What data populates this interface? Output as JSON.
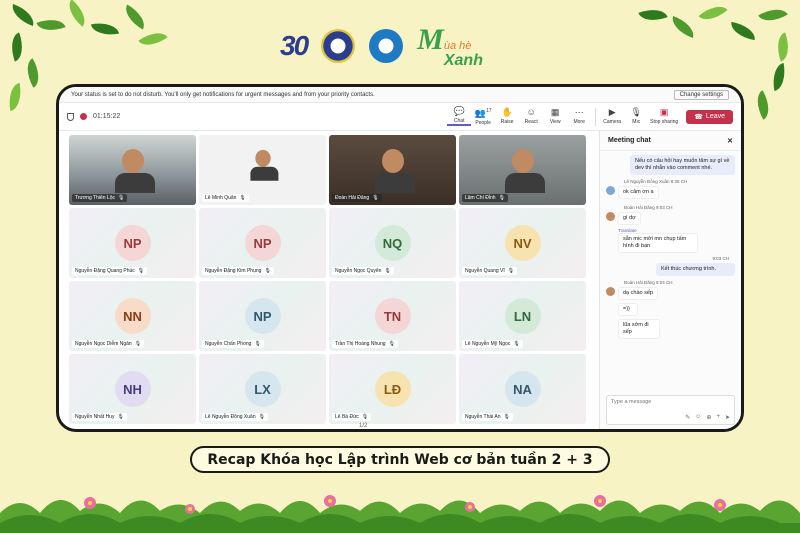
{
  "logos": {
    "brand_30": "30",
    "brand_mua_he": "ùa hè",
    "brand_xanh": "Xanh"
  },
  "notice": {
    "text": "Your status is set to do not disturb. You'll only get notifications for urgent messages and from your priority contacts.",
    "button": "Change settings"
  },
  "toolbar": {
    "timer": "01:15:22",
    "chat": "Chat",
    "people": "People",
    "people_count": "17",
    "raise": "Raise",
    "react": "React",
    "view": "View",
    "more": "More",
    "camera": "Camera",
    "mic": "Mic",
    "share": "Stop sharing",
    "leave": "Leave"
  },
  "participants": [
    {
      "name": "Trương Thiên Lộc",
      "initials": "",
      "type": "video1"
    },
    {
      "name": "Lê Minh Quân",
      "initials": "",
      "type": "video2"
    },
    {
      "name": "Đoàn Hải Đăng",
      "initials": "",
      "type": "video3"
    },
    {
      "name": "Lâm Chí Đỉnh",
      "initials": "",
      "type": "video4"
    },
    {
      "name": "Nguyễn Đặng Quang Phúc",
      "initials": "NP",
      "color": "#f5d6d6",
      "text": "#9a3a3a"
    },
    {
      "name": "Nguyễn Đặng Kim Phụng",
      "initials": "NP",
      "color": "#f5d6d6",
      "text": "#9a3a3a"
    },
    {
      "name": "Nguyễn Ngọc Quyên",
      "initials": "NQ",
      "color": "#d3ead8",
      "text": "#2f6b3c"
    },
    {
      "name": "Nguyễn Quang Vĩ",
      "initials": "NV",
      "color": "#f6e3b0",
      "text": "#8a5a10"
    },
    {
      "name": "Nguyễn Ngọc Diễm Ngân",
      "initials": "NN",
      "color": "#f8dcc8",
      "text": "#8a3e12"
    },
    {
      "name": "Nguyễn Chấn Phong",
      "initials": "NP",
      "color": "#d6e6ee",
      "text": "#2f5a6e"
    },
    {
      "name": "Trần Thị Hoàng Nhung",
      "initials": "TN",
      "color": "#f5d6d6",
      "text": "#9a3a3a"
    },
    {
      "name": "Lê Nguyễn Mỹ Ngọc",
      "initials": "LN",
      "color": "#d3ead8",
      "text": "#2f6b3c"
    },
    {
      "name": "Nguyễn Nhất Huy",
      "initials": "NH",
      "color": "#e1dcf1",
      "text": "#4a3c80"
    },
    {
      "name": "Lê Nguyễn Đông Xuân",
      "initials": "LX",
      "color": "#d6e6ee",
      "text": "#2f5a6e"
    },
    {
      "name": "Lê Bá Đức",
      "initials": "LĐ",
      "color": "#f6e3b0",
      "text": "#8a5a10"
    },
    {
      "name": "Nguyễn Thái An",
      "initials": "NA",
      "color": "#d6e6ee",
      "text": "#2f5a6e"
    }
  ],
  "pager": "1/2",
  "chat": {
    "title": "Meeting chat",
    "msg1": "Nếu có câu hỏi hay muốn tâm sự gì về dev thì nhắn vào comment nhé.",
    "meta2": "Lê Nguyễn Đông Xuân  8:38 CH",
    "msg2": "ok cảm ơn a",
    "meta3": "Đoàn Hải Đăng  9:03 CH",
    "msg3": "gì dợ",
    "translate": "Translate",
    "msg4": "sẵn mic mời mn chụp tấm hình đi bạn",
    "meta5": "9:03 CH",
    "msg5": "Kết thúc chương trình.",
    "meta6": "Đoàn Hải Đăng  9:04 CH",
    "msg6": "dạ chào sếp",
    "msg7": "=))",
    "msg8": "lũa sớm đi sếp",
    "compose_placeholder": "Type a message"
  },
  "caption": "Recap Khóa học Lập trình Web cơ bản tuần 2 + 3"
}
